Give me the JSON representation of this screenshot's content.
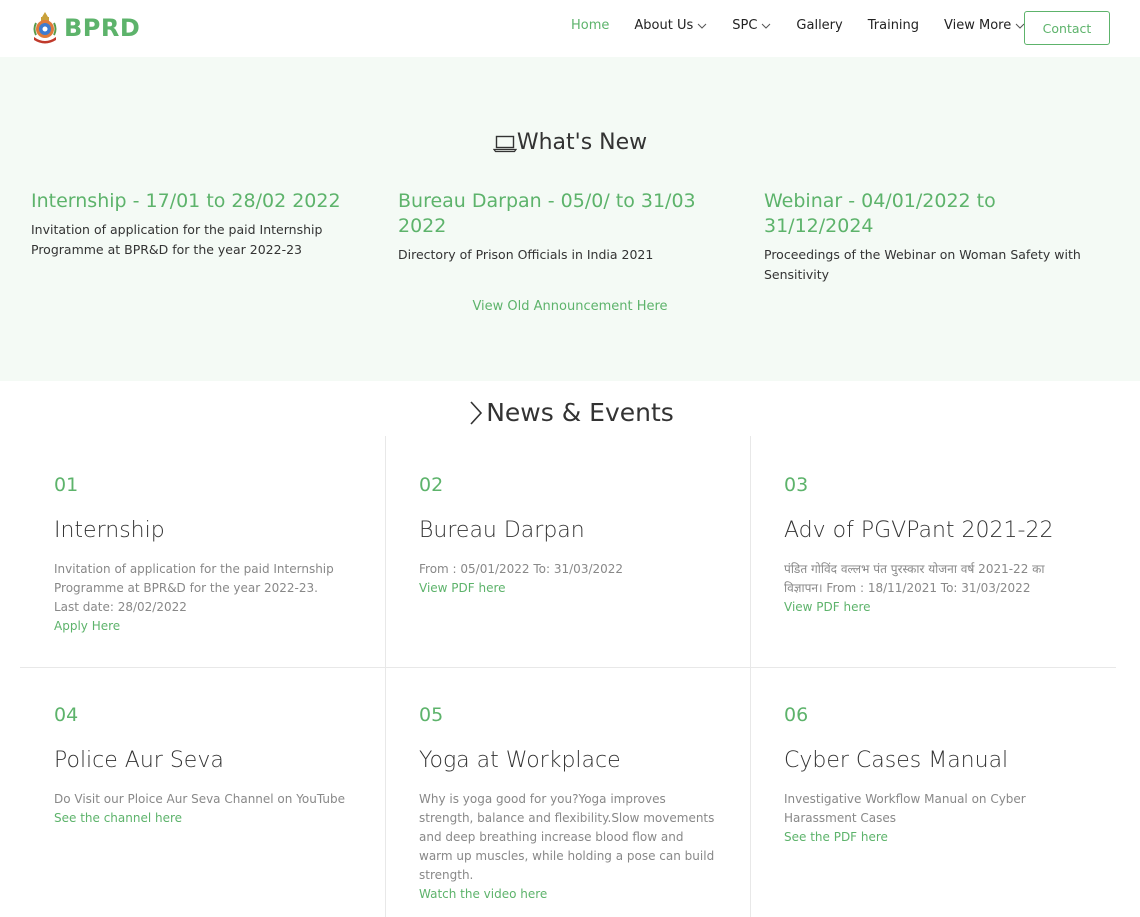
{
  "header": {
    "logo_text": "BPRD",
    "nav": [
      {
        "label": "Home",
        "active": true,
        "dropdown": false
      },
      {
        "label": "About Us",
        "active": false,
        "dropdown": true
      },
      {
        "label": "SPC",
        "active": false,
        "dropdown": true
      },
      {
        "label": "Gallery",
        "active": false,
        "dropdown": false
      },
      {
        "label": "Training",
        "active": false,
        "dropdown": false
      },
      {
        "label": "View More",
        "active": false,
        "dropdown": true
      }
    ],
    "contact_label": "Contact"
  },
  "whats_new": {
    "title": "What's New",
    "icon": "laptop-icon",
    "items": [
      {
        "heading": "Internship - 17/01 to 28/02 2022",
        "description": "Invitation of application for the paid Internship Programme at BPR&D for the year 2022-23"
      },
      {
        "heading": "Bureau Darpan - 05/0/ to 31/03 2022",
        "description": "Directory of Prison Officials in India 2021"
      },
      {
        "heading": "Webinar - 04/01/2022 to 31/12/2024",
        "description": "Proceedings of the Webinar on Woman Safety with Sensitivity"
      }
    ],
    "old_link": "View Old Announcement Here"
  },
  "news_events": {
    "title": "News & Events",
    "icon": "chevron-right-icon",
    "cards": [
      {
        "num": "01",
        "title": "Internship",
        "description": "Invitation of application for the paid Internship Programme at BPR&D for the year 2022-23. Last date: 28/02/2022",
        "link": "Apply Here"
      },
      {
        "num": "02",
        "title": "Bureau Darpan",
        "description": "From : 05/01/2022 To: 31/03/2022",
        "link": "View PDF here"
      },
      {
        "num": "03",
        "title": "Adv of PGVPant 2021-22",
        "description": "पंडित गोविंद वल्लभ पंत पुरस्कार योजना वर्ष 2021-22 का विज्ञापन। From : 18/11/2021 To: 31/03/2022",
        "link": "View PDF here"
      },
      {
        "num": "04",
        "title": "Police Aur Seva",
        "description": "Do Visit our Ploice Aur Seva Channel on YouTube",
        "link": "See the channel here"
      },
      {
        "num": "05",
        "title": "Yoga at Workplace",
        "description": "Why is yoga good for you?Yoga improves strength, balance and flexibility.Slow movements and deep breathing increase blood flow and warm up muscles, while holding a pose can build strength.",
        "link": "Watch the video here"
      },
      {
        "num": "06",
        "title": "Cyber Cases Manual",
        "description": "Investigative Workflow Manual on Cyber Harassment Cases",
        "link": "See the PDF here"
      }
    ]
  },
  "colors": {
    "accent": "#5db36b",
    "section_bg": "#f4faf5"
  }
}
